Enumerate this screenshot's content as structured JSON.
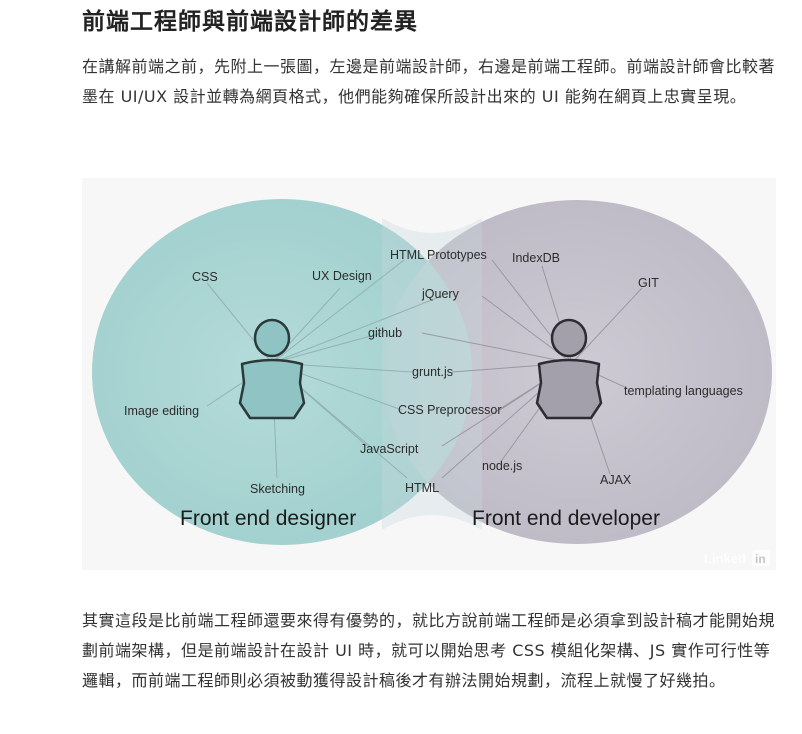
{
  "article": {
    "heading": "前端工程師與前端設計師的差異",
    "paragraph1": "在講解前端之前，先附上一張圖，左邊是前端設計師，右邊是前端工程師。前端設計師會比較著墨在 UI/UX 設計並轉為網頁格式，他們能夠確保所設計出來的 UI 能夠在網頁上忠實呈現。",
    "paragraph2": "其實這段是比前端工程師還要來得有優勢的，就比方說前端工程師是必須拿到設計稿才能開始規劃前端架構，但是前端設計在設計 UI 時，就可以開始思考 CSS 模組化架構、JS 實作可行性等邏輯，而前端工程師則必須被動獲得設計稿後才有辦法開始規劃，流程上就慢了好幾拍。"
  },
  "figure": {
    "colors": {
      "designer": "#a8d4d2",
      "developer": "#c3bfca",
      "person_designer": "#8fc3c4",
      "person_developer": "#a39fab"
    },
    "designer_title": "Front end designer",
    "developer_title": "Front end developer",
    "designer_skills": [
      "CSS",
      "UX Design",
      "Image editing",
      "Sketching"
    ],
    "shared_skills": [
      "HTML Prototypes",
      "jQuery",
      "github",
      "grunt.js",
      "CSS Preprocessor",
      "JavaScript",
      "HTML"
    ],
    "developer_skills": [
      "IndexDB",
      "GIT",
      "templating languages",
      "node.js",
      "AJAX"
    ],
    "watermark": {
      "brand": "Linked",
      "suffix": "in"
    },
    "icons": [
      "designer-person-icon",
      "developer-person-icon"
    ]
  }
}
